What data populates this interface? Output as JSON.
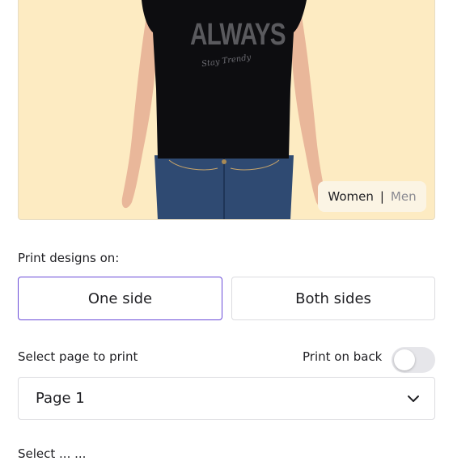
{
  "preview": {
    "shirt_print_main": "ALWAYS",
    "shirt_print_sub": "Stay Trendy",
    "gender_toggle": {
      "active": "Women",
      "separator": "|",
      "inactive": "Men"
    },
    "background_color": "#fdebc2"
  },
  "print_sides": {
    "label": "Print designs on:",
    "options": [
      {
        "label": "One side",
        "selected": true
      },
      {
        "label": "Both sides",
        "selected": false
      }
    ],
    "selected_border_color": "#6a4bd8"
  },
  "page_select": {
    "label": "Select page to print",
    "print_on_back_label": "Print on back",
    "print_on_back_enabled": false,
    "value": "Page 1"
  },
  "next_section": {
    "label": "Select ... ..."
  }
}
